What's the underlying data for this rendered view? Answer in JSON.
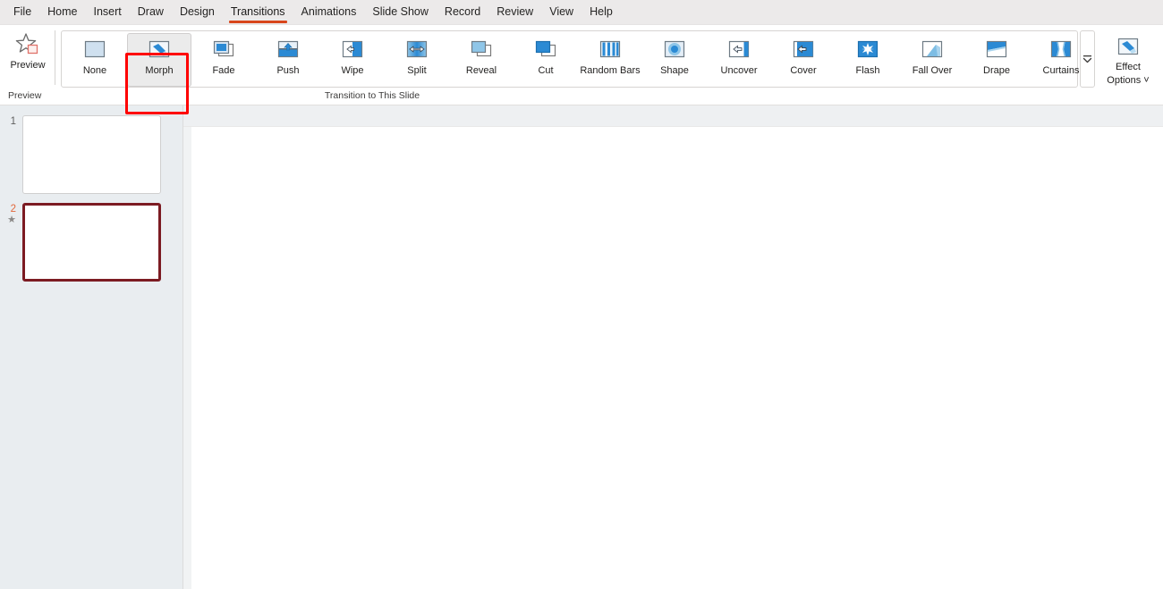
{
  "menubar": {
    "tabs": [
      {
        "label": "File",
        "active": false
      },
      {
        "label": "Home",
        "active": false
      },
      {
        "label": "Insert",
        "active": false
      },
      {
        "label": "Draw",
        "active": false
      },
      {
        "label": "Design",
        "active": false
      },
      {
        "label": "Transitions",
        "active": true
      },
      {
        "label": "Animations",
        "active": false
      },
      {
        "label": "Slide Show",
        "active": false
      },
      {
        "label": "Record",
        "active": false
      },
      {
        "label": "Review",
        "active": false
      },
      {
        "label": "View",
        "active": false
      },
      {
        "label": "Help",
        "active": false
      }
    ]
  },
  "ribbon": {
    "preview_group": {
      "group_label": "Preview",
      "button_label": "Preview",
      "icon": "preview-star-icon"
    },
    "transition_group": {
      "group_label": "Transition to This Slide",
      "scroll_button_icon": "gallery-more-chevron-icon",
      "items": [
        {
          "label": "None",
          "icon": "transition-none-icon",
          "selected": false
        },
        {
          "label": "Morph",
          "icon": "transition-morph-icon",
          "selected": true
        },
        {
          "label": "Fade",
          "icon": "transition-fade-icon",
          "selected": false
        },
        {
          "label": "Push",
          "icon": "transition-push-icon",
          "selected": false
        },
        {
          "label": "Wipe",
          "icon": "transition-wipe-icon",
          "selected": false
        },
        {
          "label": "Split",
          "icon": "transition-split-icon",
          "selected": false
        },
        {
          "label": "Reveal",
          "icon": "transition-reveal-icon",
          "selected": false
        },
        {
          "label": "Cut",
          "icon": "transition-cut-icon",
          "selected": false
        },
        {
          "label": "Random Bars",
          "icon": "transition-random-bars-icon",
          "selected": false
        },
        {
          "label": "Shape",
          "icon": "transition-shape-icon",
          "selected": false
        },
        {
          "label": "Uncover",
          "icon": "transition-uncover-icon",
          "selected": false
        },
        {
          "label": "Cover",
          "icon": "transition-cover-icon",
          "selected": false
        },
        {
          "label": "Flash",
          "icon": "transition-flash-icon",
          "selected": false
        },
        {
          "label": "Fall Over",
          "icon": "transition-fall-over-icon",
          "selected": false
        },
        {
          "label": "Drape",
          "icon": "transition-drape-icon",
          "selected": false
        },
        {
          "label": "Curtains",
          "icon": "transition-curtains-icon",
          "selected": false
        }
      ]
    },
    "effect_options": {
      "label_line1": "Effect",
      "label_line2": "Options",
      "dropdown_caret": "˅",
      "icon": "effect-options-icon"
    }
  },
  "annotation": {
    "target": "Morph",
    "color": "#fe0000"
  },
  "slide_panel": {
    "slides": [
      {
        "number": "1",
        "selected": false,
        "has_transition": false,
        "star": ""
      },
      {
        "number": "2",
        "selected": true,
        "has_transition": true,
        "star": "★"
      }
    ]
  },
  "colors": {
    "accent_tab_underline": "#d8461b",
    "selected_slide_border": "#7c1b22",
    "selected_slide_number": "#e2683c",
    "annotation_red": "#fe0000",
    "icon_blue": "#2b8ad4",
    "ribbon_bg": "#ffffff",
    "thumbpane_bg": "#e9edf0"
  }
}
